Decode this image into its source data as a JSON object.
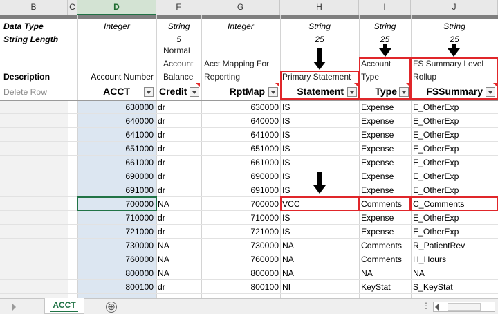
{
  "column_headers": [
    "B",
    "C",
    "D",
    "F",
    "G",
    "H",
    "I",
    "J"
  ],
  "meta_labels": {
    "data_type": "Data Type",
    "string_length": "String Length",
    "description": "Description",
    "delete_row": "Delete Row"
  },
  "columns": {
    "d": {
      "data_type": "Integer",
      "string_length": "",
      "description": "Account Number",
      "field": "ACCT"
    },
    "f": {
      "data_type": "String",
      "string_length": "5",
      "description": "Normal Account Balance",
      "desc_lines": [
        "Normal",
        "Account",
        "Balance"
      ],
      "field": "Credit"
    },
    "g": {
      "data_type": "Integer",
      "string_length": "",
      "desc_lines": [
        "Acct Mapping For",
        "Reporting"
      ],
      "field": "RptMap"
    },
    "h": {
      "data_type": "String",
      "string_length": "25",
      "desc_lines": [
        "Primary Statement"
      ],
      "field": "Statement"
    },
    "i": {
      "data_type": "String",
      "string_length": "25",
      "desc_lines": [
        "Account",
        "Type"
      ],
      "field": "Type"
    },
    "j": {
      "data_type": "String",
      "string_length": "25",
      "desc_lines": [
        "FS Summary Level",
        "Rollup"
      ],
      "field": "FSSummary"
    }
  },
  "rows": [
    {
      "acct": "630000",
      "credit": "dr",
      "rptmap": "630000",
      "statement": "IS",
      "type": "Expense",
      "fssummary": "E_OtherExp"
    },
    {
      "acct": "640000",
      "credit": "dr",
      "rptmap": "640000",
      "statement": "IS",
      "type": "Expense",
      "fssummary": "E_OtherExp"
    },
    {
      "acct": "641000",
      "credit": "dr",
      "rptmap": "641000",
      "statement": "IS",
      "type": "Expense",
      "fssummary": "E_OtherExp"
    },
    {
      "acct": "651000",
      "credit": "dr",
      "rptmap": "651000",
      "statement": "IS",
      "type": "Expense",
      "fssummary": "E_OtherExp"
    },
    {
      "acct": "661000",
      "credit": "dr",
      "rptmap": "661000",
      "statement": "IS",
      "type": "Expense",
      "fssummary": "E_OtherExp"
    },
    {
      "acct": "690000",
      "credit": "dr",
      "rptmap": "690000",
      "statement": "IS",
      "type": "Expense",
      "fssummary": "E_OtherExp"
    },
    {
      "acct": "691000",
      "credit": "dr",
      "rptmap": "691000",
      "statement": "IS",
      "type": "Expense",
      "fssummary": "E_OtherExp"
    },
    {
      "acct": "700000",
      "credit": "NA",
      "rptmap": "700000",
      "statement": "VCC",
      "type": "Comments",
      "fssummary": "C_Comments"
    },
    {
      "acct": "710000",
      "credit": "dr",
      "rptmap": "710000",
      "statement": "IS",
      "type": "Expense",
      "fssummary": "E_OtherExp"
    },
    {
      "acct": "721000",
      "credit": "dr",
      "rptmap": "721000",
      "statement": "IS",
      "type": "Expense",
      "fssummary": "E_OtherExp"
    },
    {
      "acct": "730000",
      "credit": "NA",
      "rptmap": "730000",
      "statement": "NA",
      "type": "Comments",
      "fssummary": "R_PatientRev"
    },
    {
      "acct": "760000",
      "credit": "NA",
      "rptmap": "760000",
      "statement": "NA",
      "type": "Comments",
      "fssummary": "H_Hours"
    },
    {
      "acct": "800000",
      "credit": "NA",
      "rptmap": "800000",
      "statement": "NA",
      "type": "NA",
      "fssummary": "NA"
    },
    {
      "acct": "800100",
      "credit": "dr",
      "rptmap": "800100",
      "statement": "NI",
      "type": "KeyStat",
      "fssummary": "S_KeyStat"
    }
  ],
  "sheet_tab": "ACCT",
  "add_sheet_icon": "⊕",
  "overflow_dots": "⋮",
  "colors": {
    "accent": "#217346",
    "highlight_box": "#e0262a",
    "acct_column_fill": "#dce6f1"
  }
}
